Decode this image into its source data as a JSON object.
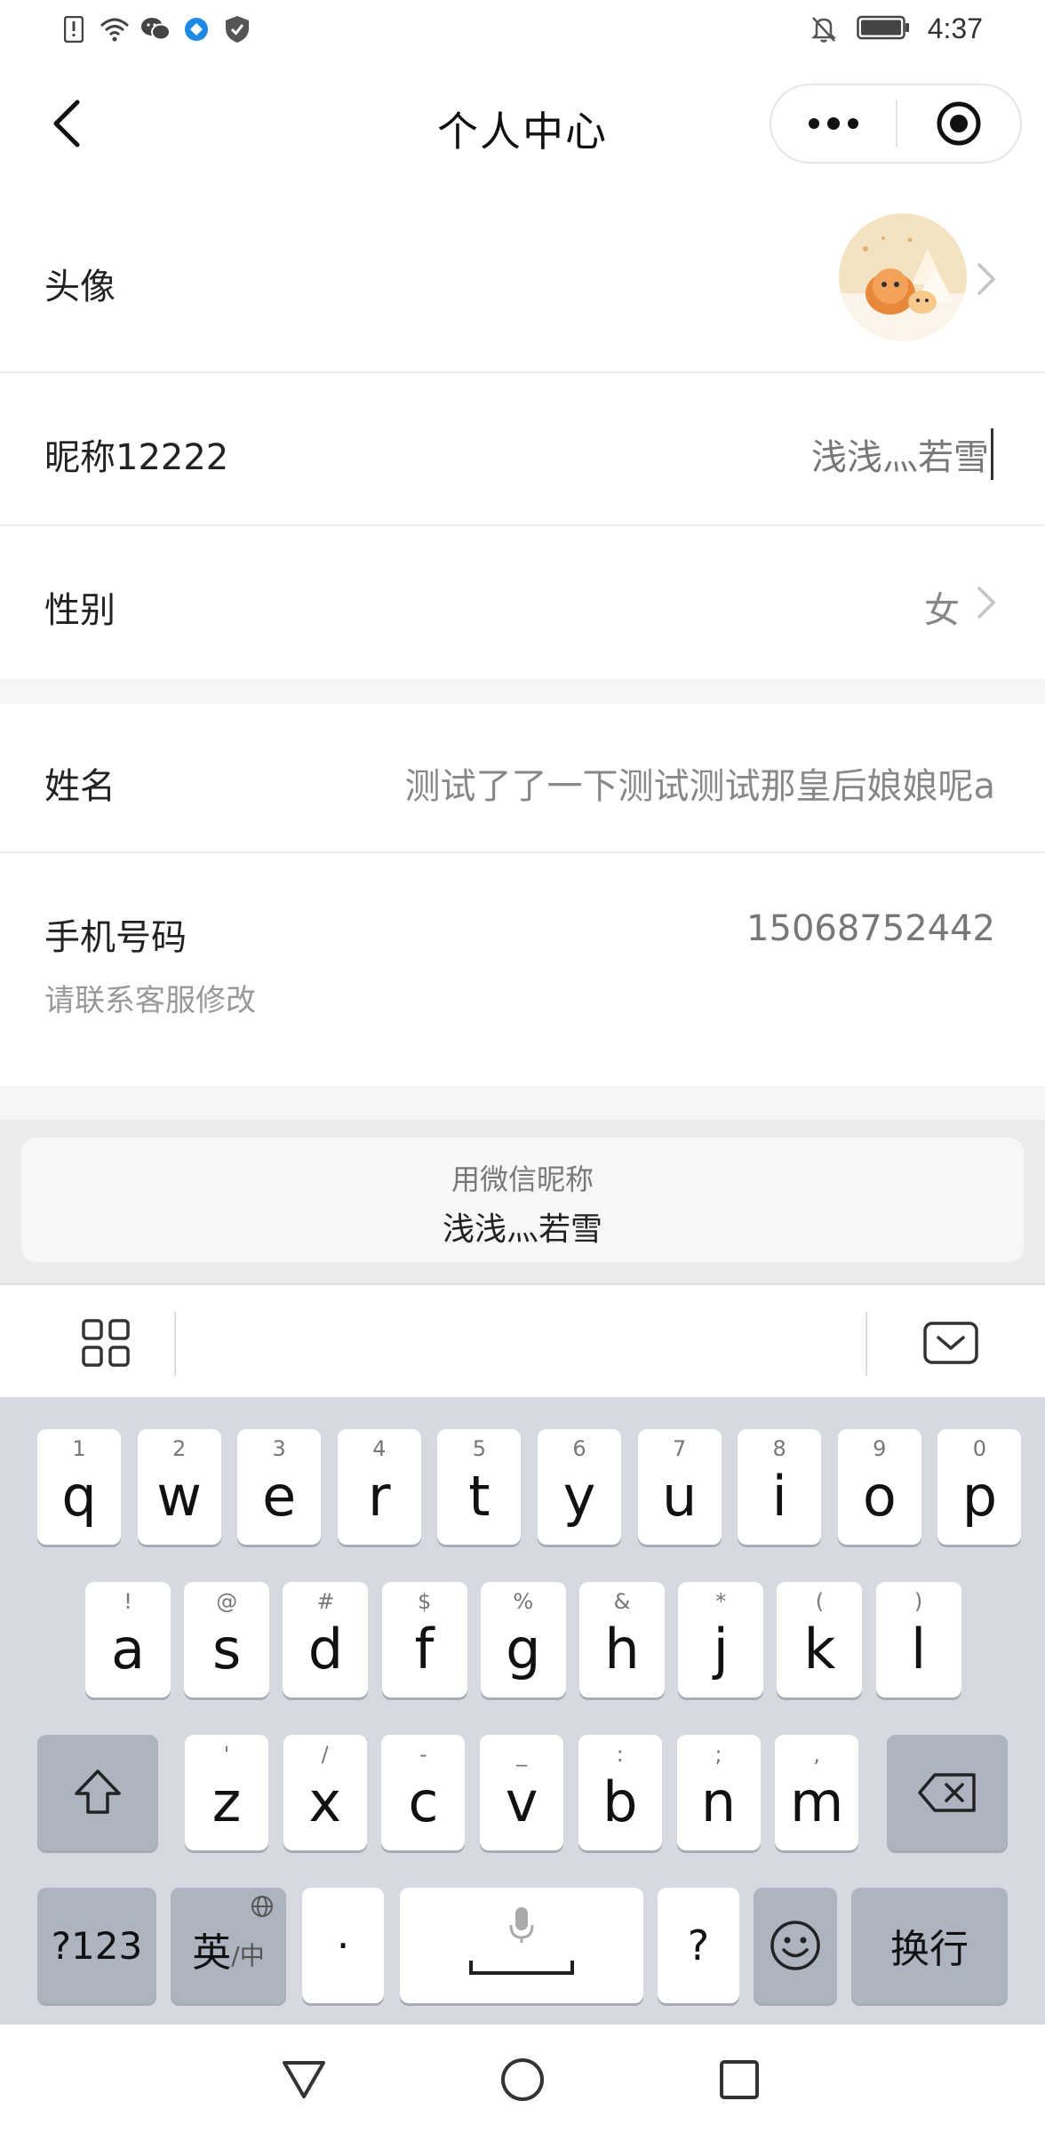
{
  "status": {
    "time": "4:37",
    "icons": [
      "alert-icon",
      "wifi-icon",
      "wechat-icon",
      "app-icon",
      "shield-icon"
    ],
    "right_icons": [
      "mute-icon",
      "battery-icon"
    ]
  },
  "nav": {
    "title": "个人中心",
    "back_icon": "back-chevron-icon",
    "more_icon": "more-dots-icon",
    "close_icon": "target-icon"
  },
  "profile": {
    "avatar_label": "头像",
    "nickname_label": "昵称12222",
    "nickname_value": "浅浅灬若雪",
    "gender_label": "性别",
    "gender_value": "女",
    "name_label": "姓名",
    "name_value": "测试了了一下测试测试那皇后娘娘呢a",
    "phone_label": "手机号码",
    "phone_value": "15068752442",
    "phone_hint": "请联系客服修改"
  },
  "suggestion": {
    "title": "用微信昵称",
    "name": "浅浅灬若雪"
  },
  "keyboard": {
    "row1": [
      {
        "sub": "1",
        "key": "q"
      },
      {
        "sub": "2",
        "key": "w"
      },
      {
        "sub": "3",
        "key": "e"
      },
      {
        "sub": "4",
        "key": "r"
      },
      {
        "sub": "5",
        "key": "t"
      },
      {
        "sub": "6",
        "key": "y"
      },
      {
        "sub": "7",
        "key": "u"
      },
      {
        "sub": "8",
        "key": "i"
      },
      {
        "sub": "9",
        "key": "o"
      },
      {
        "sub": "0",
        "key": "p"
      }
    ],
    "row2": [
      {
        "sub": "!",
        "key": "a"
      },
      {
        "sub": "@",
        "key": "s"
      },
      {
        "sub": "#",
        "key": "d"
      },
      {
        "sub": "$",
        "key": "f"
      },
      {
        "sub": "%",
        "key": "g"
      },
      {
        "sub": "&",
        "key": "h"
      },
      {
        "sub": "*",
        "key": "j"
      },
      {
        "sub": "(",
        "key": "k"
      },
      {
        "sub": ")",
        "key": "l"
      }
    ],
    "row3": [
      {
        "sub": "'",
        "key": "z"
      },
      {
        "sub": "/",
        "key": "x"
      },
      {
        "sub": "-",
        "key": "c"
      },
      {
        "sub": "_",
        "key": "v"
      },
      {
        "sub": ":",
        "key": "b"
      },
      {
        "sub": ";",
        "key": "n"
      },
      {
        "sub": ",",
        "key": "m"
      }
    ],
    "symbols_label": "?123",
    "lang_main": "英",
    "lang_sub": "/中",
    "period": "·",
    "question": "?",
    "enter_label": "换行"
  }
}
